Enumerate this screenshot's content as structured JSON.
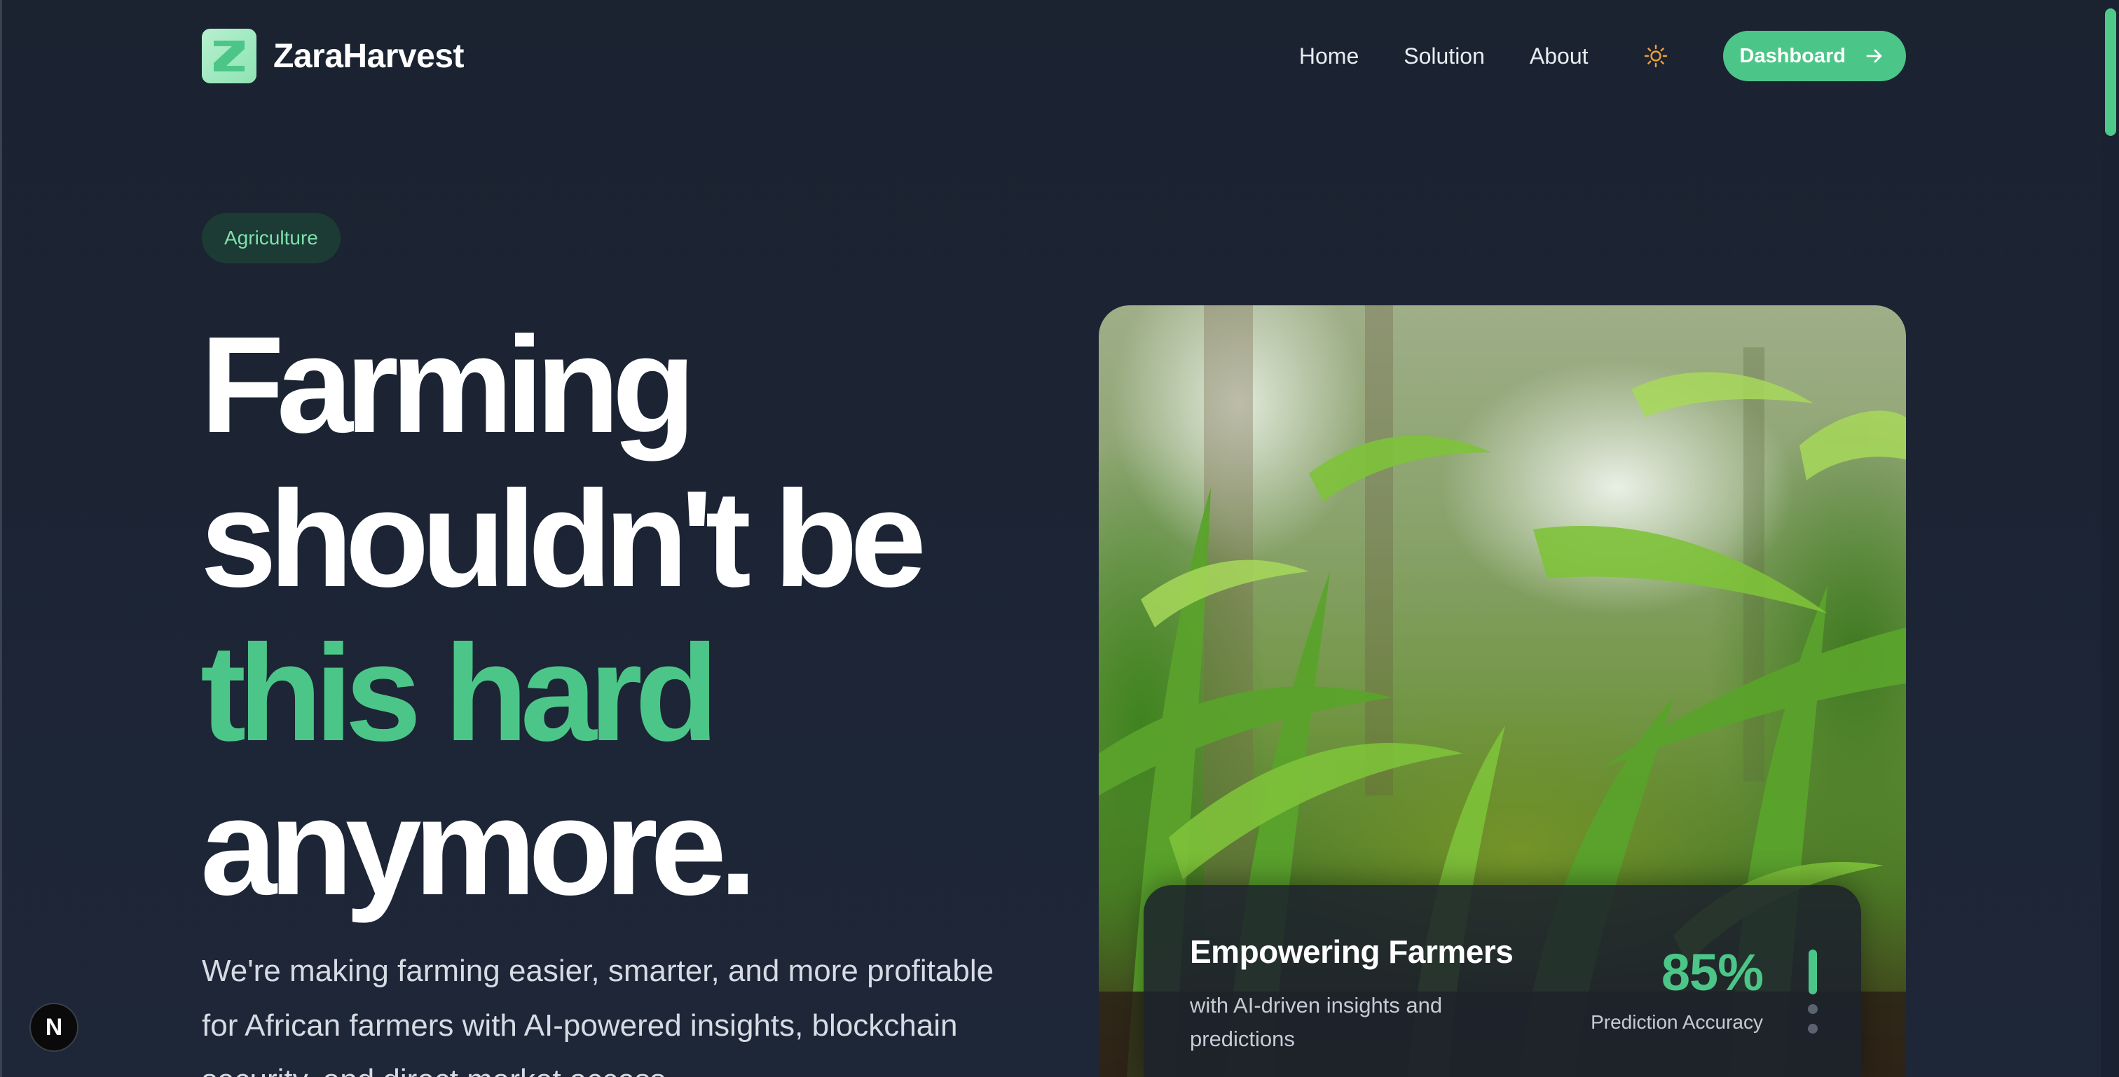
{
  "nav": {
    "brand": "ZaraHarvest",
    "logo_letter": "Z",
    "links": [
      "Home",
      "Solution",
      "About"
    ],
    "theme_icon": "sun-icon",
    "dashboard_label": "Dashboard",
    "dashboard_icon": "arrow-right-icon"
  },
  "hero": {
    "badge": "Agriculture",
    "headline": [
      "Farming",
      "shouldn't be",
      "this hard",
      "anymore."
    ],
    "subtext": "We're making farming easier, smarter, and more profitable for African farmers with AI-powered insights, blockchain security, and direct market access."
  },
  "stats_card": {
    "title": "Empowering Farmers",
    "description": "with AI-driven insights and predictions",
    "value": "85%",
    "label": "Prediction Accuracy",
    "slides_total": 3,
    "slide_active": 1
  },
  "dev_badge": {
    "letter": "N"
  },
  "colors": {
    "background": "#1c2434",
    "accent": "#4cc688",
    "badge_bg": "#1c3b35",
    "badge_text": "#7fe0ae"
  }
}
